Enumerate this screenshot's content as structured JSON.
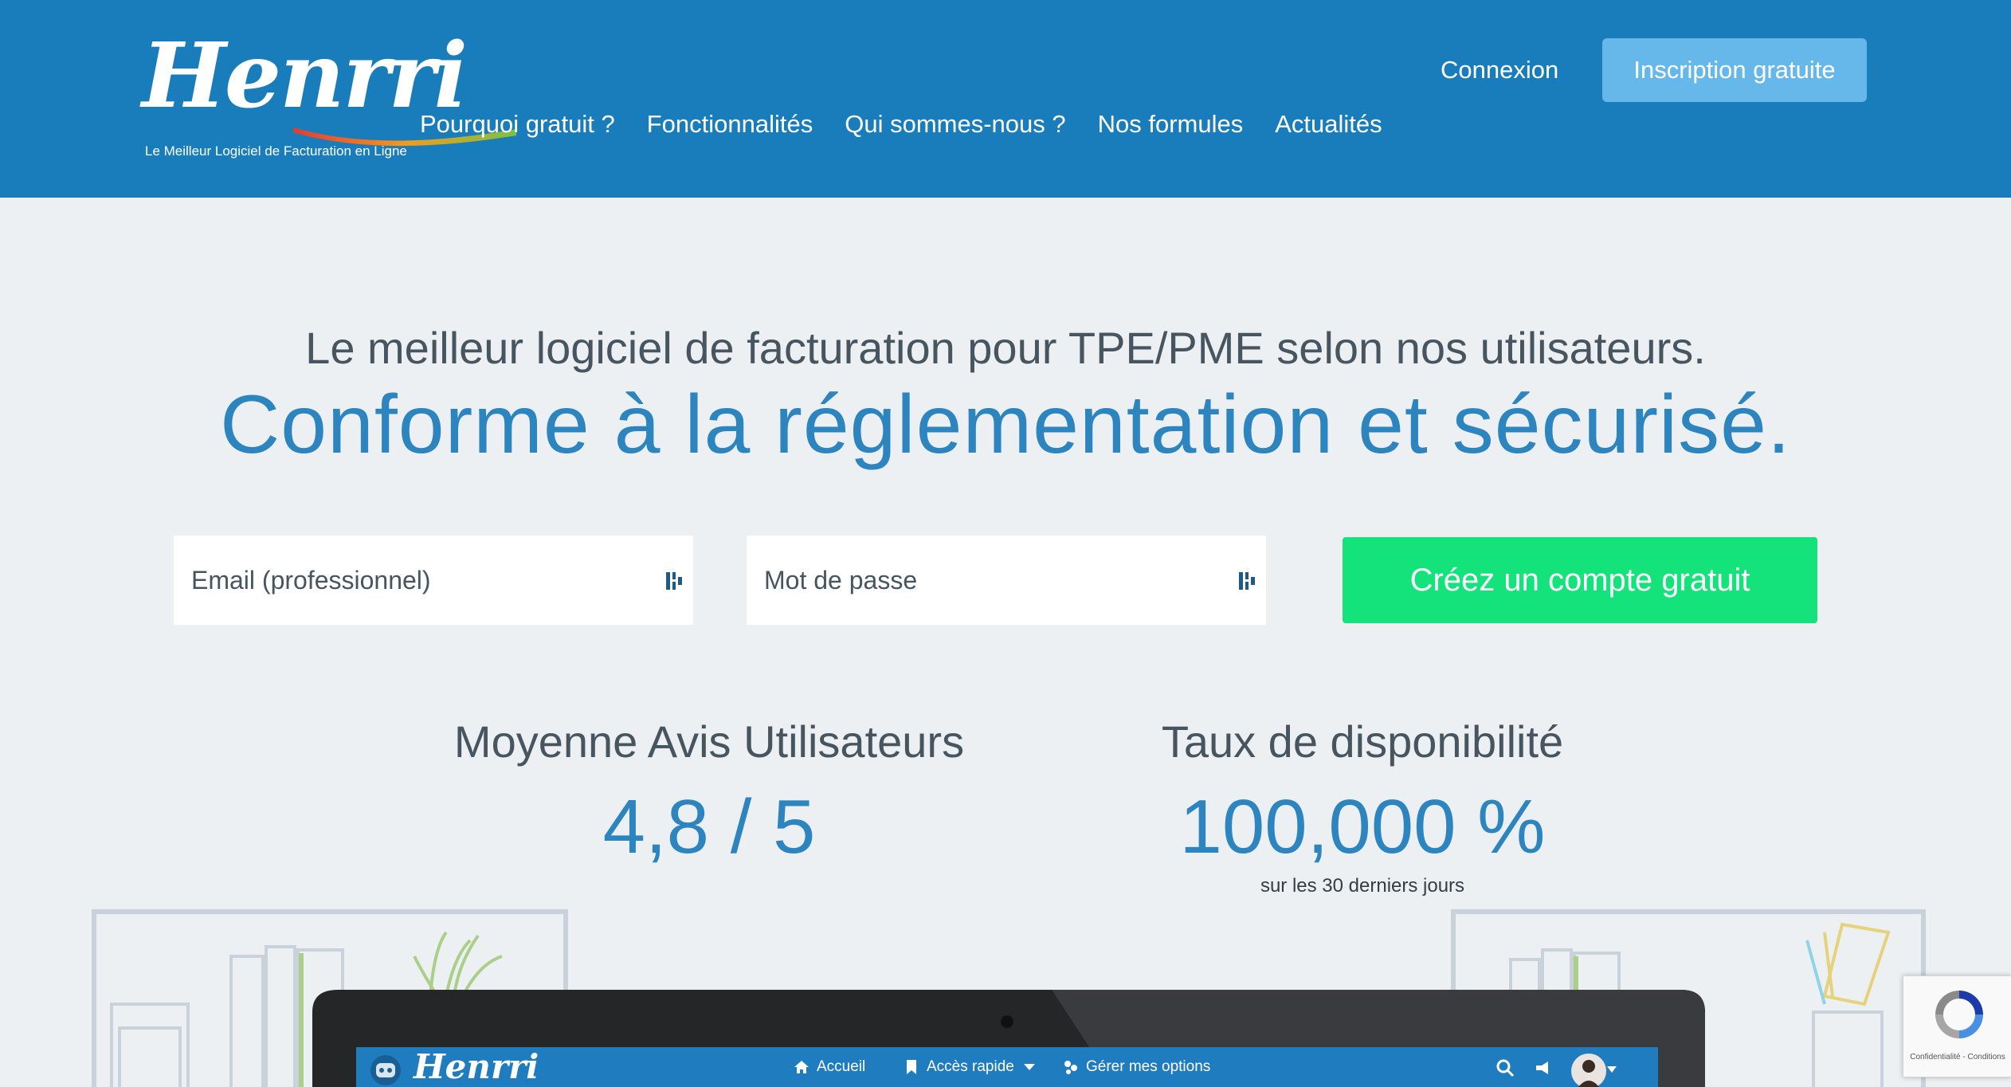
{
  "header": {
    "logo_text": "Henrri",
    "logo_tagline": "Le Meilleur Logiciel de Facturation en Ligne",
    "nav": [
      {
        "label": "Pourquoi gratuit ?"
      },
      {
        "label": "Fonctionnalités"
      },
      {
        "label": "Qui sommes-nous ?"
      },
      {
        "label": "Nos formules"
      },
      {
        "label": "Actualités"
      }
    ],
    "login_label": "Connexion",
    "signup_label": "Inscription gratuite"
  },
  "hero": {
    "headline": "Le meilleur logiciel de facturation pour TPE/PME selon nos utilisateurs.",
    "subheadline": "Conforme à la réglementation et sécurisé.",
    "email_placeholder": "Email (professionnel)",
    "password_placeholder": "Mot de passe",
    "cta_label": "Créez un compte gratuit"
  },
  "stats": {
    "rating_label": "Moyenne Avis Utilisateurs",
    "rating_value": "4,8 / 5",
    "uptime_label": "Taux de disponibilité",
    "uptime_value": "100,000 %",
    "uptime_note": "sur les 30 derniers jours"
  },
  "app_preview": {
    "logo_text": "Henrri",
    "nav": [
      {
        "label": "Accueil",
        "icon": "home-icon"
      },
      {
        "label": "Accès rapide",
        "icon": "bookmark-icon"
      },
      {
        "label": "Gérer mes options",
        "icon": "options-icon"
      }
    ]
  },
  "recaptcha": {
    "footer": "Confidentialité - Conditions"
  },
  "colors": {
    "header_bg": "#1a7dbb",
    "page_bg": "#edf0f2",
    "signup_button": "#66b8ea",
    "cta_button": "#13e37a",
    "accent_text": "#2d85c0",
    "body_text": "#46555f"
  }
}
